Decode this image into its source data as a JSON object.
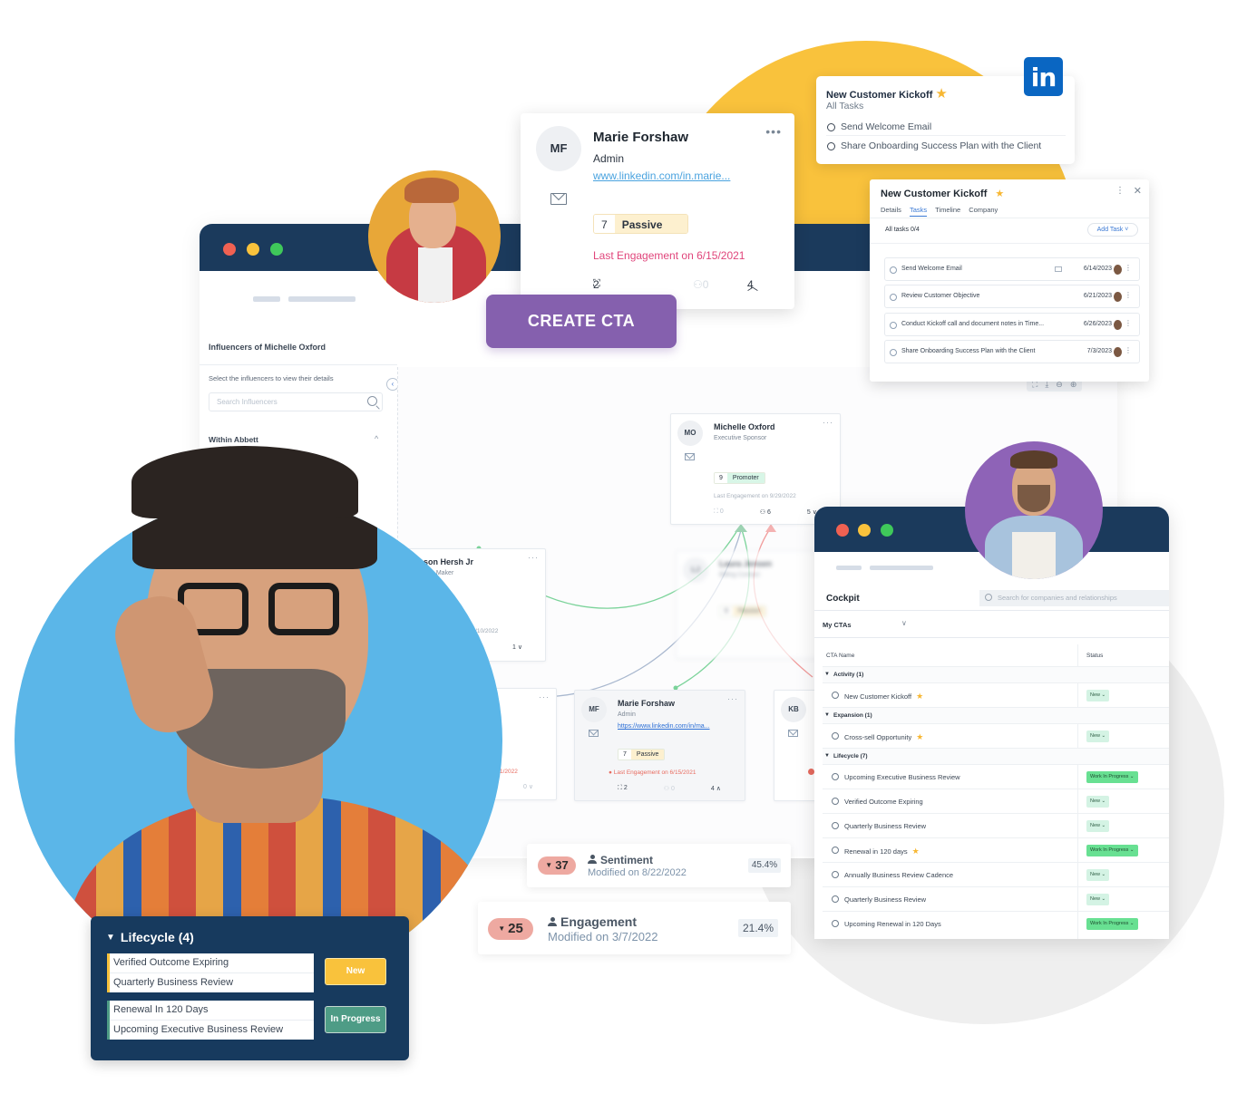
{
  "influencer_window": {
    "title": "Influencers of Michelle Oxford",
    "hint": "Select the influencers to view their details",
    "search_placeholder": "Search Influencers",
    "section": "Within Abbett",
    "collapse_glyph": "‹",
    "section_chevron": "^",
    "toolbar_icons": [
      "hierarchy-icon",
      "download-icon",
      "zoom-out-icon",
      "zoom-in-icon"
    ]
  },
  "nodes": {
    "michelle": {
      "initials": "MO",
      "name": "Michelle Oxford",
      "role": "Executive Sponsor",
      "score": "9",
      "score_label": "Promoter",
      "last_engagement": "Last Engagement on 9/29/2022",
      "reports": "0",
      "influencers": "6",
      "count": "5 ∨",
      "color": "#d8f6e7"
    },
    "jason": {
      "name": "son Hersh Jr",
      "role": "n Maker",
      "last_engagement": "n 8/10/2022",
      "count": "1 ∨"
    },
    "left_partial": {
      "last_engagement": "1/2022",
      "count": "0 ∨"
    },
    "marie": {
      "initials": "MF",
      "name": "Marie Forshaw",
      "role": "Admin",
      "link": "https://www.linkedin.com/in/ma...",
      "score": "7",
      "score_label": "Passive",
      "last_engagement": "Last Engagement on 6/15/2021",
      "reports": "2",
      "influencers": "0",
      "count": "4 ∧"
    },
    "kb": {
      "initials": "KB"
    },
    "blurred": {
      "name": "Laura Jensen",
      "role": "Billing Contact",
      "score": "6",
      "score_label": "Passive"
    }
  },
  "marie_card": {
    "initials": "MF",
    "name": "Marie Forshaw",
    "role": "Admin",
    "link": "www.linkedin.com/in.marie...",
    "score": "7",
    "score_label": "Passive",
    "last_engagement": "Last Engagement on 6/15/2021",
    "reports": "2",
    "influencers": "0",
    "count": "4",
    "more": "•••"
  },
  "create_cta": {
    "label": "CREATE CTA"
  },
  "linkedin_task": {
    "title": "New Customer Kickoff",
    "subtitle": "All Tasks",
    "items": [
      "Send Welcome Email",
      "Share Onboarding Success Plan with the Client"
    ],
    "logo": "in"
  },
  "tasks_popup": {
    "title": "New Customer Kickoff",
    "tabs": [
      "Details",
      "Tasks",
      "Timeline",
      "Company"
    ],
    "active_tab": "Tasks",
    "all_tasks": "All tasks 0/4",
    "add_task": "Add Task ˅",
    "tasks": [
      {
        "name": "Send Welcome Email",
        "date": "6/14/2023",
        "has_email": true
      },
      {
        "name": "Review Customer Objective",
        "date": "6/21/2023",
        "has_email": false
      },
      {
        "name": "Conduct Kickoff call and document notes in Time...",
        "date": "6/26/2023",
        "has_email": false
      },
      {
        "name": "Share Onboarding Success Plan with the Client",
        "date": "7/3/2023",
        "has_email": false
      }
    ]
  },
  "cockpit": {
    "title": "Cockpit",
    "search_placeholder": "Search for companies and relationships",
    "filter": "My CTAs",
    "columns": [
      "CTA Name",
      "Status"
    ],
    "groups": [
      {
        "name": "Activity (1)",
        "items": [
          {
            "name": "New Customer Kickoff",
            "starred": true,
            "status": "New"
          }
        ]
      },
      {
        "name": "Expansion (1)",
        "items": [
          {
            "name": "Cross-sell Opportunity",
            "starred": true,
            "status": "New"
          }
        ]
      },
      {
        "name": "Lifecycle (7)",
        "items": [
          {
            "name": "Upcoming Executive Business Review",
            "starred": false,
            "status": "Work In Progress"
          },
          {
            "name": "Verified Outcome Expiring",
            "starred": false,
            "status": "New"
          },
          {
            "name": "Quarterly Business Review",
            "starred": false,
            "status": "New"
          },
          {
            "name": "Renewal in 120 days",
            "starred": true,
            "status": "Work In Progress"
          },
          {
            "name": "Annually Business Review Cadence",
            "starred": false,
            "status": "New"
          },
          {
            "name": "Quarterly Business Review",
            "starred": false,
            "status": "New"
          },
          {
            "name": "Upcoming Renewal in 120 Days",
            "starred": false,
            "status": "Work In Progress"
          }
        ]
      }
    ]
  },
  "metrics": {
    "sentiment": {
      "delta": "37",
      "label": "Sentiment",
      "modified": "Modified on 8/22/2022",
      "pct": "45.4%"
    },
    "engagement": {
      "delta": "25",
      "label": "Engagement",
      "modified": "Modified on 3/7/2022",
      "pct": "21.4%"
    }
  },
  "lifecycle_card": {
    "title": "Lifecycle (4)",
    "groups": [
      {
        "items": [
          "Verified Outcome Expiring",
          "Quarterly Business Review"
        ],
        "status": "New",
        "color": "#f9c23c"
      },
      {
        "items": [
          "Renewal In 120 Days",
          "Upcoming Executive Business Review"
        ],
        "status": "In Progress",
        "color": "#4e9c86"
      }
    ]
  },
  "colors": {
    "navy": "#1b3a5c",
    "yellow": "#f9c23c",
    "purple": "#8560ae",
    "linkedin": "#0a66c2",
    "wip_green": "#68e092",
    "new_green": "#d4f3e4",
    "engagement_red": "#e0457b"
  }
}
